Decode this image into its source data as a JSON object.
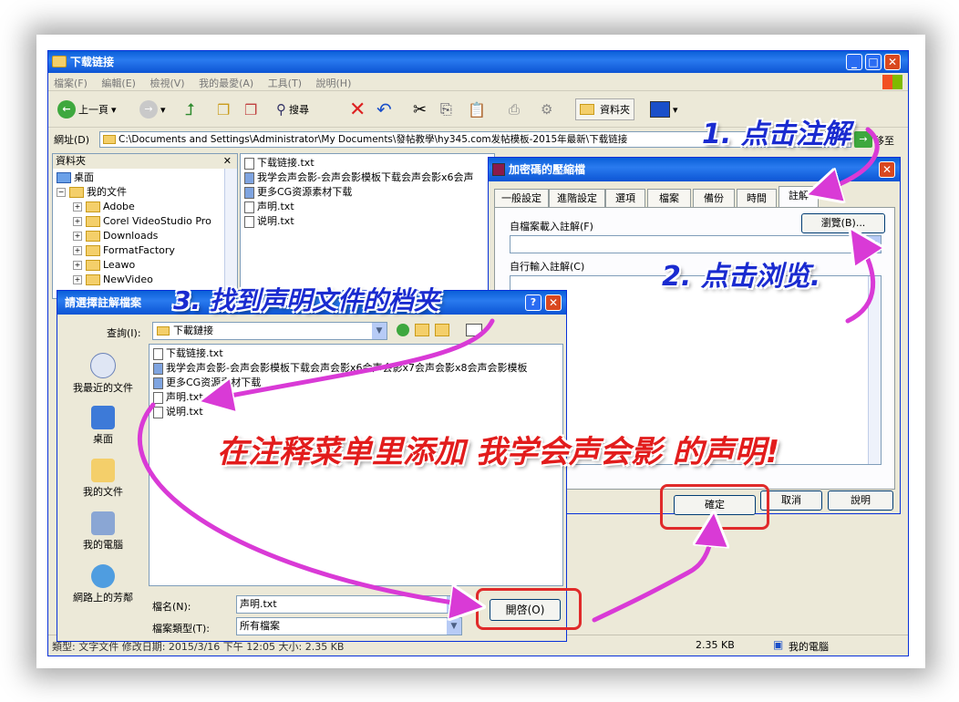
{
  "explorer": {
    "title": "下载链接",
    "menu": [
      "檔案(F)",
      "編輯(E)",
      "檢視(V)",
      "我的最愛(A)",
      "工具(T)",
      "說明(H)"
    ],
    "toolbar": {
      "back": "上一頁",
      "search": "搜尋",
      "folders": "資料夾"
    },
    "address_label": "網址(D)",
    "address": "C:\\Documents and Settings\\Administrator\\My Documents\\發帖教學\\hy345.com发帖模板-2015年最新\\下载链接",
    "go": "移至",
    "folders_pane_title": "資料夾",
    "tree": [
      {
        "label": "桌面"
      },
      {
        "label": "我的文件"
      },
      {
        "label": "Adobe"
      },
      {
        "label": "Corel VideoStudio Pro"
      },
      {
        "label": "Downloads"
      },
      {
        "label": "FormatFactory"
      },
      {
        "label": "Leawo"
      },
      {
        "label": "NewVideo"
      }
    ],
    "files": [
      "下载链接.txt",
      "我学会声会影-会声会影模板下载会声会影x6会声",
      "更多CG资源素材下载",
      "声明.txt",
      "说明.txt"
    ],
    "status": {
      "left": "類型: 文字文件 修改日期: 2015/3/16 下午 12:05 大小: 2.35 KB",
      "size": "2.35 KB",
      "location": "我的電腦"
    }
  },
  "rar": {
    "title": "加密碼的壓縮檔",
    "tabs": [
      "一般設定",
      "進階設定",
      "選項",
      "檔案",
      "備份",
      "時間",
      "註解"
    ],
    "load_label": "自檔案載入註解(F)",
    "browse": "瀏覽(B)...",
    "manual_label": "自行輸入註解(C)",
    "ok": "確定",
    "cancel": "取消",
    "help": "說明"
  },
  "open": {
    "title": "請選擇註解檔案",
    "lookin_label": "查詢(I):",
    "lookin_value": "下載鏈接",
    "help_btn": "?",
    "places": [
      "我最近的文件",
      "桌面",
      "我的文件",
      "我的電腦",
      "網路上的芳鄰"
    ],
    "files": [
      "下载链接.txt",
      "我学会声会影-会声会影模板下载会声会影x6会声会影x7会声会影x8会声会影模板",
      "更多CG资源素材下载",
      "声明.txt",
      "说明.txt"
    ],
    "filename_label": "檔名(N):",
    "filename_value": "声明.txt",
    "filetype_label": "檔案類型(T):",
    "filetype_value": "所有檔案",
    "open_btn": "開啓(O)"
  },
  "annotations": {
    "step1": "1. 点击注解",
    "step2": "2. 点击浏览.",
    "step3": "3. 找到声明文件的档夹",
    "caption": "在注释菜单里添加 我学会声会影 的声明!"
  },
  "colors": {
    "title_blue": "#0a5fd8",
    "arrow_pink": "#d93ad6",
    "highlight_red": "#e02a2a",
    "anno_blue": "#1a2bd0",
    "anno_red": "#e21c1c"
  }
}
